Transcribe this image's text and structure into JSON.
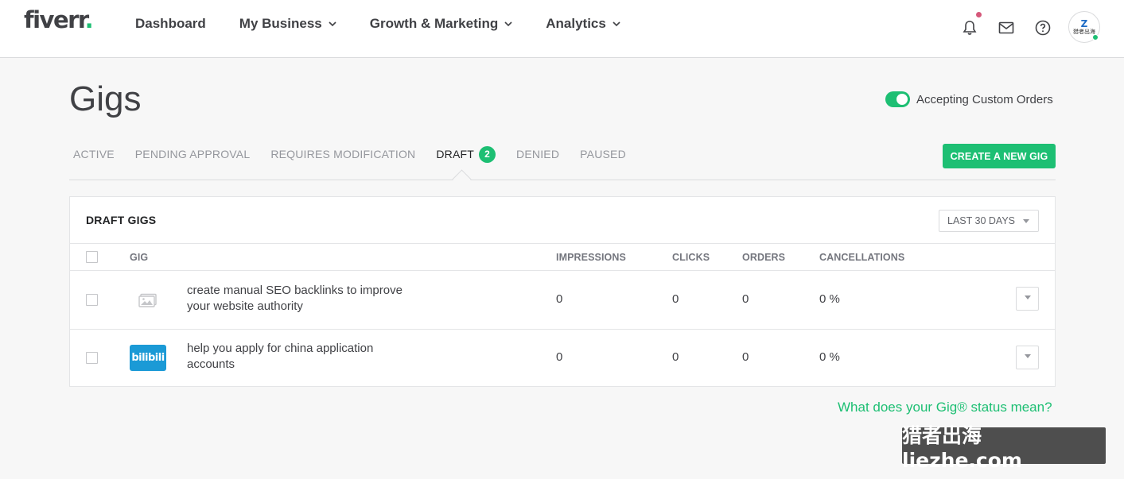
{
  "header": {
    "logo": "fiverr",
    "logo_dot": ".",
    "nav": [
      {
        "label": "Dashboard",
        "has_dropdown": false
      },
      {
        "label": "My Business",
        "has_dropdown": true
      },
      {
        "label": "Growth & Marketing",
        "has_dropdown": true
      },
      {
        "label": "Analytics",
        "has_dropdown": true
      }
    ],
    "icons": [
      "bell-icon",
      "envelope-icon",
      "help-icon"
    ],
    "avatar": {
      "line1": "Z",
      "line2": "猎者出海"
    }
  },
  "page": {
    "title": "Gigs",
    "custom_orders_label": "Accepting Custom Orders",
    "custom_orders_enabled": true
  },
  "tabs": {
    "items": [
      {
        "label": "ACTIVE"
      },
      {
        "label": "PENDING APPROVAL"
      },
      {
        "label": "REQUIRES MODIFICATION"
      },
      {
        "label": "DRAFT",
        "count": "2",
        "active": true
      },
      {
        "label": "DENIED"
      },
      {
        "label": "PAUSED"
      }
    ],
    "create_button": "CREATE A NEW GIG"
  },
  "table": {
    "title": "DRAFT GIGS",
    "range": "LAST 30 DAYS",
    "columns": {
      "gig": "GIG",
      "impressions": "IMPRESSIONS",
      "clicks": "CLICKS",
      "orders": "ORDERS",
      "cancellations": "CANCELLATIONS"
    },
    "rows": [
      {
        "title": "create manual SEO backlinks to improve your website authority",
        "thumb": "image-placeholder-icon",
        "impressions": "0",
        "clicks": "0",
        "orders": "0",
        "cancellations": "0 %"
      },
      {
        "title": "help you apply for china application accounts",
        "thumb": "bilibili",
        "thumb_text": "bilibili",
        "impressions": "0",
        "clicks": "0",
        "orders": "0",
        "cancellations": "0 %"
      }
    ]
  },
  "help_link": "What does your Gig® status mean?",
  "watermark": "猎者出海 liezhe.com",
  "colors": {
    "accent": "#1dbf73",
    "text": "#404145",
    "muted": "#95979d",
    "notification": "#d5587a",
    "bilibili": "#1b9ad6"
  }
}
